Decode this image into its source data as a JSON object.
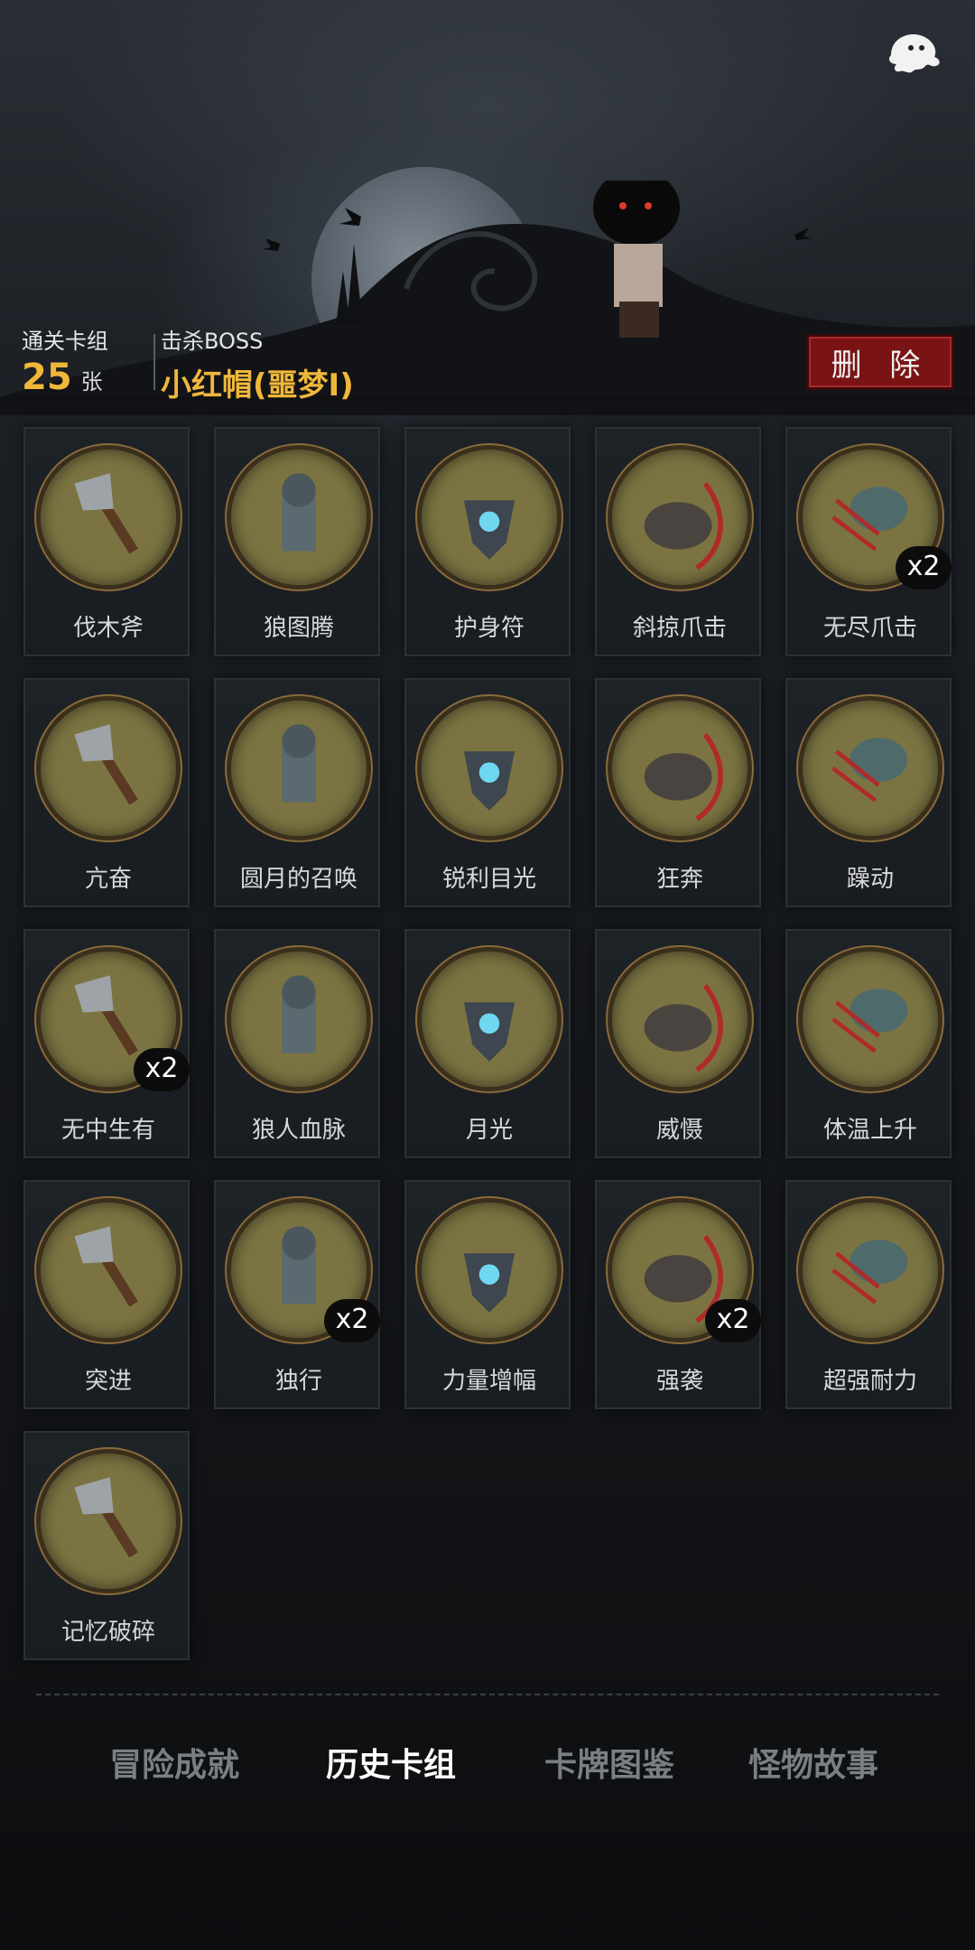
{
  "header": {
    "clear_deck_label": "通关卡组",
    "card_count": "25",
    "card_unit": "张",
    "boss_label": "击杀BOSS",
    "boss_name": "小红帽(噩梦I)",
    "delete_label": "删 除",
    "back_icon": "ghost-icon"
  },
  "cards": [
    {
      "name": "伐木斧",
      "badge": "",
      "icon": "axe-icon"
    },
    {
      "name": "狼图腾",
      "badge": "",
      "icon": "wolf-totem-icon"
    },
    {
      "name": "护身符",
      "badge": "",
      "icon": "amulet-icon"
    },
    {
      "name": "斜掠爪击",
      "badge": "",
      "icon": "claw-strike-icon"
    },
    {
      "name": "无尽爪击",
      "badge": "x2",
      "icon": "endless-claw-icon"
    },
    {
      "name": "亢奋",
      "badge": "",
      "icon": "werewolf-rage-icon"
    },
    {
      "name": "圆月的召唤",
      "badge": "",
      "icon": "full-moon-forest-icon"
    },
    {
      "name": "锐利目光",
      "badge": "",
      "icon": "sharp-eyes-icon"
    },
    {
      "name": "狂奔",
      "badge": "",
      "icon": "running-wolf-icon"
    },
    {
      "name": "躁动",
      "badge": "",
      "icon": "restless-icon"
    },
    {
      "name": "无中生有",
      "badge": "x2",
      "icon": "creation-icon"
    },
    {
      "name": "狼人血脉",
      "badge": "",
      "icon": "werewolf-blood-icon"
    },
    {
      "name": "月光",
      "badge": "",
      "icon": "moonlight-icon"
    },
    {
      "name": "威慑",
      "badge": "",
      "icon": "intimidate-icon"
    },
    {
      "name": "体温上升",
      "badge": "",
      "icon": "fever-icon"
    },
    {
      "name": "突进",
      "badge": "",
      "icon": "charge-icon"
    },
    {
      "name": "独行",
      "badge": "x2",
      "icon": "lone-walk-icon"
    },
    {
      "name": "力量增幅",
      "badge": "",
      "icon": "log-carry-icon"
    },
    {
      "name": "强袭",
      "badge": "x2",
      "icon": "assault-icon"
    },
    {
      "name": "超强耐力",
      "badge": "",
      "icon": "endurance-icon"
    },
    {
      "name": "记忆破碎",
      "badge": "",
      "icon": "broken-memory-icon"
    }
  ],
  "tabs": [
    {
      "label": "冒险成就",
      "active": false
    },
    {
      "label": "历史卡组",
      "active": true
    },
    {
      "label": "卡牌图鉴",
      "active": false
    },
    {
      "label": "怪物故事",
      "active": false
    }
  ],
  "colors": {
    "accent_gold": "#f0b73a",
    "delete_red": "#7a1414",
    "art_olive": "#7b7442"
  }
}
